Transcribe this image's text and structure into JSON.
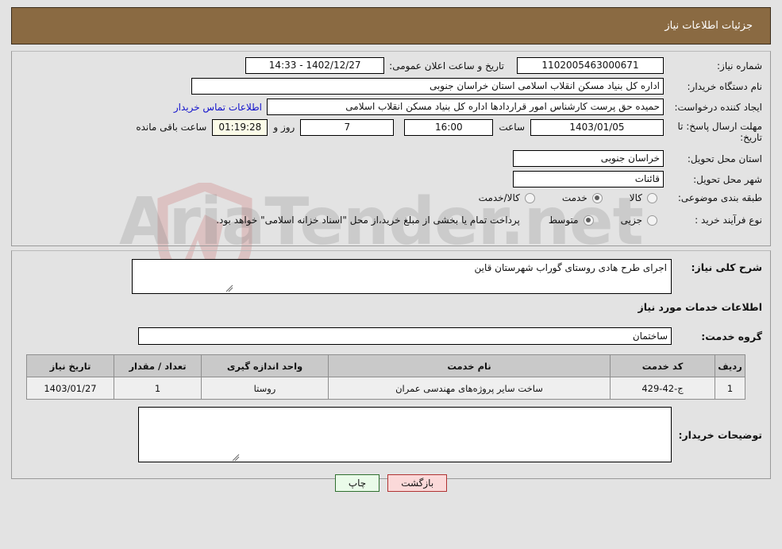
{
  "header": {
    "title": "جزئیات اطلاعات نیاز"
  },
  "form": {
    "need_number_label": "شماره نیاز:",
    "need_number_value": "1102005463000671",
    "announce_datetime_label": "تاریخ و ساعت اعلان عمومی:",
    "announce_datetime_value": "1402/12/27 - 14:33",
    "buyer_org_label": "نام دستگاه خریدار:",
    "buyer_org_value": "اداره کل بنیاد مسکن انقلاب اسلامی استان خراسان جنوبی",
    "creator_label": "ایجاد کننده درخواست:",
    "creator_value": "حمیده حق پرست کارشناس امور قراردادها اداره کل بنیاد مسکن انقلاب اسلامی",
    "contact_link": "اطلاعات تماس خریدار",
    "deadline_label": "مهلت ارسال پاسخ: تا تاریخ:",
    "deadline_date": "1403/01/05",
    "hour_label": "ساعت",
    "hour_value": "16:00",
    "days_value": "7",
    "days_and_label": "روز و",
    "countdown_value": "01:19:28",
    "remaining_label": "ساعت باقی مانده",
    "province_label": "استان محل تحویل:",
    "province_value": "خراسان جنوبی",
    "city_label": "شهر محل تحویل:",
    "city_value": "قائنات",
    "category_label": "طبقه بندی موضوعی:",
    "category_options": [
      {
        "label": "کالا",
        "selected": false
      },
      {
        "label": "خدمت",
        "selected": true
      },
      {
        "label": "کالا/خدمت",
        "selected": false
      }
    ],
    "process_label": "نوع فرآیند خرید :",
    "process_options": [
      {
        "label": "جزیی",
        "selected": false
      },
      {
        "label": "متوسط",
        "selected": true
      }
    ],
    "treasury_note": "پرداخت تمام یا بخشی از مبلغ خرید،از محل \"اسناد خزانه اسلامی\" خواهد بود."
  },
  "details": {
    "general_desc_label": "شرح کلی نیاز:",
    "general_desc_value": "اجرای طرح هادی روستای گوراب شهرستان قاین",
    "services_section_title": "اطلاعات خدمات مورد نیاز",
    "service_group_label": "گروه خدمت:",
    "service_group_value": "ساختمان",
    "buyer_notes_label": "توضیحات خریدار:",
    "buyer_notes_value": ""
  },
  "table": {
    "columns": [
      "ردیف",
      "کد خدمت",
      "نام خدمت",
      "واحد اندازه گیری",
      "تعداد / مقدار",
      "تاریخ نیاز"
    ],
    "rows": [
      {
        "index": "1",
        "code": "ج-42-429",
        "name": "ساخت سایر پروژه‌های مهندسی عمران",
        "unit": "روستا",
        "quantity": "1",
        "need_date": "1403/01/27"
      }
    ]
  },
  "buttons": {
    "print": "چاپ",
    "back": "بازگشت"
  },
  "watermark": {
    "text": "AriaTender.net"
  },
  "colors": {
    "header_bg": "#8a6a42",
    "page_bg": "#e3e3e3",
    "link": "#1212cc",
    "print_btn_bg": "#eafbe9",
    "back_btn_bg": "#fbd9d9",
    "countdown_bg": "#fbfbe8",
    "table_header_bg": "#c9c9c9"
  }
}
